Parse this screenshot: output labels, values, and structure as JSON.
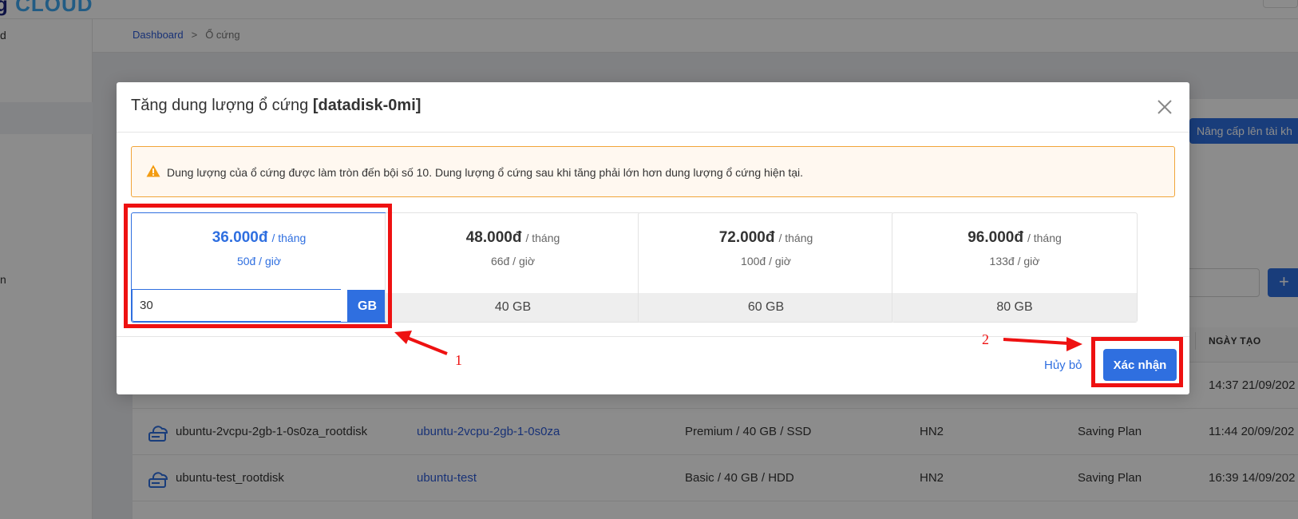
{
  "app": {
    "logo_text_dark": "g",
    "logo_text_accent": "CLOUD"
  },
  "sidebar": {
    "items": [
      {
        "label": "d"
      },
      {
        "label": "n"
      }
    ]
  },
  "breadcrumb": {
    "items": [
      "Dashboard",
      "Ổ cứng"
    ],
    "separator": ">"
  },
  "page": {
    "upgrade_label": "Nâng cấp lên tài kh",
    "add_label": "+",
    "table_header_date": "NGÀY TẠO",
    "rows": [
      {
        "name": "ubuntu-2vcpu-2gb-1-0s0za_rootdisk",
        "server": "ubuntu-2vcpu-2gb-1-0s0za",
        "type": "Premium / 40 GB / SSD",
        "region": "HN2",
        "plan": "Saving Plan",
        "created": "11:44 20/09/202"
      },
      {
        "name": "ubuntu-test_rootdisk",
        "server": "ubuntu-test",
        "type": "Basic / 40 GB / HDD",
        "region": "HN2",
        "plan": "Saving Plan",
        "created": "16:39 14/09/202"
      }
    ],
    "hidden_row_created": "14:37 21/09/202"
  },
  "modal": {
    "title_prefix": "Tăng dung lượng ổ cứng",
    "title_disk": "[datadisk-0mi]",
    "alert_text": "Dung lượng của ổ cứng được làm tròn đến bội số 10. Dung lượng ổ cứng sau khi tăng phải lớn hơn dung lượng ổ cứng hiện tại.",
    "plans": [
      {
        "price": "36.000đ",
        "per": "/ tháng",
        "hourly": "50đ / giờ",
        "size": "",
        "custom_value": "30",
        "unit": "GB",
        "selected": true
      },
      {
        "price": "48.000đ",
        "per": "/ tháng",
        "hourly": "66đ / giờ",
        "size": "40 GB"
      },
      {
        "price": "72.000đ",
        "per": "/ tháng",
        "hourly": "100đ / giờ",
        "size": "60 GB"
      },
      {
        "price": "96.000đ",
        "per": "/ tháng",
        "hourly": "133đ / giờ",
        "size": "80 GB"
      }
    ],
    "cancel_label": "Hủy bỏ",
    "confirm_label": "Xác nhận"
  },
  "annotations": {
    "label_1": "1",
    "label_2": "2",
    "color": "#ee1111"
  },
  "colors": {
    "primary": "#2f6fe0",
    "warning_border": "#f1a53a",
    "warning_icon": "#f39c12"
  }
}
